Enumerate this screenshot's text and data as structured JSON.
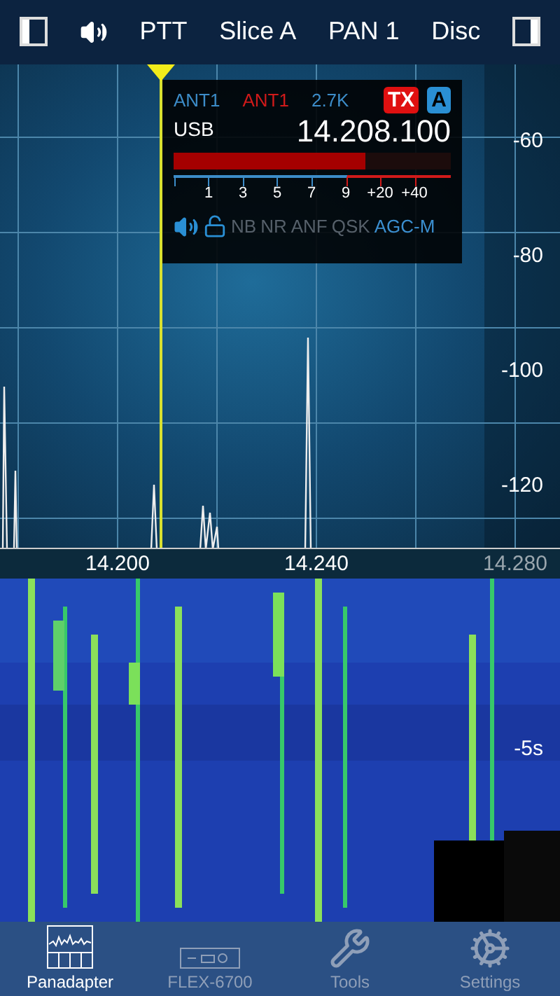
{
  "top_bar": {
    "items": [
      {
        "kind": "panel-left"
      },
      {
        "kind": "speaker"
      },
      {
        "kind": "text",
        "label": "PTT"
      },
      {
        "kind": "text",
        "label": "Slice A"
      },
      {
        "kind": "text",
        "label": "PAN 1"
      },
      {
        "kind": "text",
        "label": "Disc"
      },
      {
        "kind": "panel-right"
      }
    ]
  },
  "panadapter": {
    "db_labels": [
      "-60",
      "-80",
      "-100",
      "-120"
    ],
    "freq_labels": [
      {
        "label": "14.200",
        "dim": false
      },
      {
        "label": "14.240",
        "dim": false
      },
      {
        "label": "14.280",
        "dim": true
      }
    ]
  },
  "slice": {
    "rx_antenna": "ANT1",
    "tx_antenna": "ANT1",
    "filter": "2.7K",
    "tx": {
      "label": "TX",
      "on": true
    },
    "letter": "A",
    "mode": "USB",
    "frequency": "14.208.100",
    "level": 0.69,
    "scale": [
      "1",
      "3",
      "5",
      "7",
      "9",
      "+20",
      "+40"
    ],
    "locked": false,
    "toggles": [
      {
        "label": "NB",
        "on": false
      },
      {
        "label": "NR",
        "on": false
      },
      {
        "label": "ANF",
        "on": false
      },
      {
        "label": "QSK",
        "on": false
      },
      {
        "label": "AGC-M",
        "on": true
      }
    ]
  },
  "waterfall": {
    "time_label": "-5s"
  },
  "tabs": [
    {
      "label": "Panadapter",
      "kind": "panadapter",
      "selected": true
    },
    {
      "label": "FLEX-6700",
      "kind": "radio",
      "selected": false
    },
    {
      "label": "Tools",
      "kind": "tools",
      "selected": false
    },
    {
      "label": "Settings",
      "kind": "settings",
      "selected": false
    }
  ]
}
